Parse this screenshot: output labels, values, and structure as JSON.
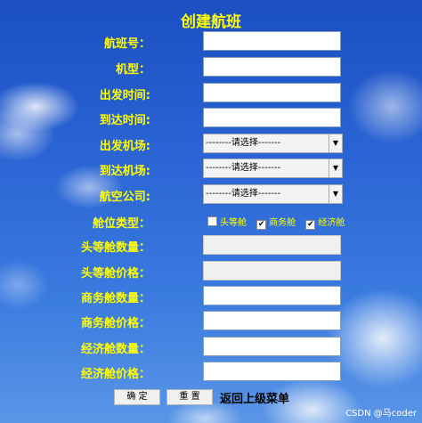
{
  "page": {
    "title": "创建航班",
    "watermark": "CSDN @马coder"
  },
  "fields": {
    "flight_no": "航班号：",
    "model": "机型：",
    "depart_time": "出发时间:",
    "arrive_time": "到达时间:",
    "depart_airport": "出发机场:",
    "arrive_airport": "到达机场:",
    "airline": "航空公司:",
    "cabin_type": "舱位类型：",
    "first_count": "头等舱数量：",
    "first_price": "头等舱价格：",
    "business_count": "商务舱数量：",
    "business_price": "商务舱价格：",
    "economy_count": "经济舱数量：",
    "economy_price": "经济舱价格："
  },
  "selects": {
    "placeholder": "--------请选择-------"
  },
  "cabins": {
    "first": {
      "label": "头等舱",
      "checked": false
    },
    "business": {
      "label": "商务舱",
      "checked": true
    },
    "economy": {
      "label": "经济舱",
      "checked": true
    }
  },
  "buttons": {
    "confirm": "确  定",
    "reset": "重  置",
    "back": "返回上级菜单"
  }
}
